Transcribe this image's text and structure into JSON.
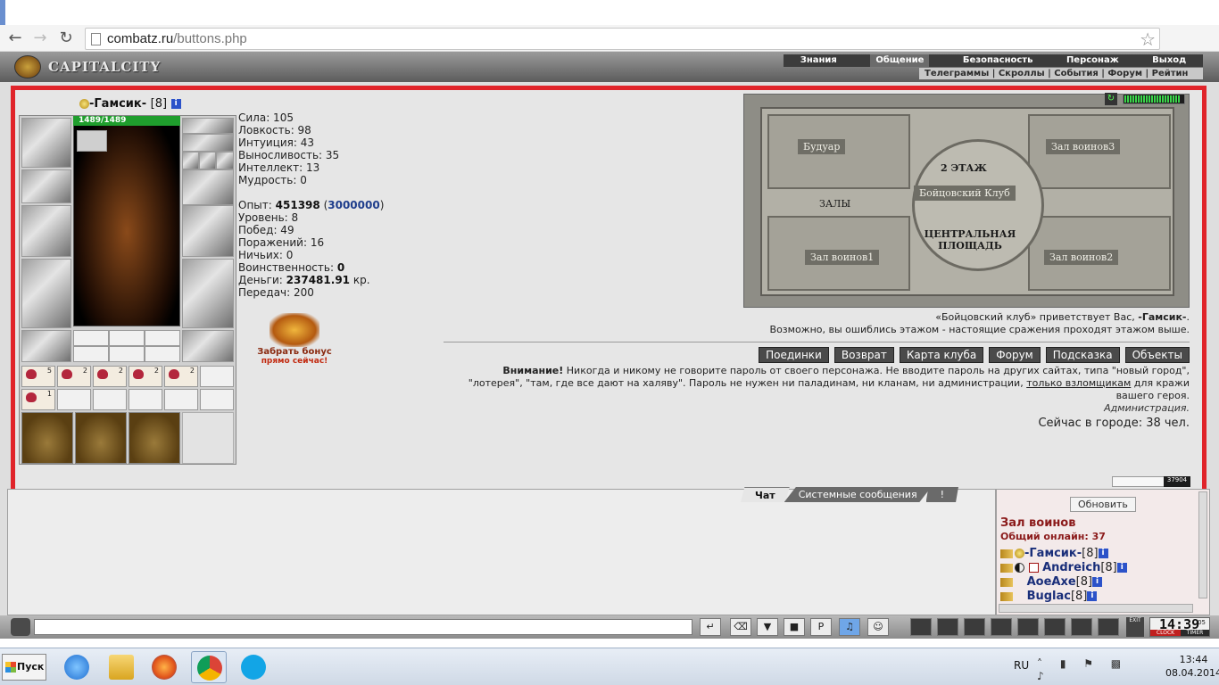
{
  "browser": {
    "url_host": "combatz.ru",
    "url_path": "/buttons.php"
  },
  "game": {
    "logo": "CAPITALCITY",
    "main_menu": [
      "Знания",
      "Общение",
      "Безопасность",
      "Персонаж",
      "Выход"
    ],
    "main_menu_active": "Общение",
    "sub_menu": "Телеграммы | Скроллы | События | Форум | Рейтин"
  },
  "character": {
    "name": "-Гамсик-",
    "level": "[8]",
    "hp": "1489/1489",
    "stats": {
      "strength": "Сила: 105",
      "agility": "Ловкость: 98",
      "intuition": "Интуиция: 43",
      "endurance": "Выносливость: 35",
      "intellect": "Интеллект: 13",
      "wisdom": "Мудрость: 0"
    },
    "exp_label": "Опыт:",
    "exp_value": "451398",
    "exp_next": "3000000",
    "level_line": "Уровень: 8",
    "wins": "Побед: 49",
    "losses": "Поражений: 16",
    "draws": "Ничьих: 0",
    "militancy_label": "Воинственность:",
    "militancy_value": "0",
    "money_label": "Деньги:",
    "money_value": "237481.91",
    "money_unit": "кр.",
    "transfers": "Передач: 200",
    "scroll_counts": [
      "5",
      "2",
      "2",
      "2",
      "2",
      "1"
    ],
    "bonus_line1": "Забрать бонус",
    "bonus_line2": "прямо сейчас!"
  },
  "map": {
    "rooms": {
      "boudoir": "Будуар",
      "hall3": "Зал воинов3",
      "floor2": "2 ЭТАЖ",
      "club": "Бойцовский Клуб",
      "halls": "ЗАЛЫ",
      "plaza": "ЦЕНТРАЛЬНАЯ ПЛОЩАДЬ",
      "hall1": "Зал воинов1",
      "hall2": "Зал воинов2"
    },
    "energy_level": 0.95
  },
  "welcome": {
    "line1_pre": "«Бойцовский клуб» приветствует Вас,",
    "line1_name": "-Гамсик-",
    "line1_end": ".",
    "line2": "Возможно, вы ошиблись этажом - настоящие сражения проходят этажом выше."
  },
  "buttons": [
    "Поединки",
    "Возврат",
    "Карта клуба",
    "Форум",
    "Подсказка",
    "Объекты"
  ],
  "warning": {
    "bold": "Внимание!",
    "text1": " Никогда и никому не говорите пароль от своего персонажа. Не вводите пароль на других сайтах, типа \"новый город\", \"лотерея\", \"там, где все дают на халяву\". Пароль не нужен ни паладинам, ни кланам, ни администрации, ",
    "link": "только взломщикам",
    "text2": " для кражи вашего героя.",
    "signature": "Администрация."
  },
  "online_city": "Сейчас в городе: 38 чел.",
  "chat": {
    "tabs": [
      "Чат",
      "Системные сообщения",
      "!"
    ],
    "active_tab": "Чат"
  },
  "counter": "37904",
  "userlist": {
    "refresh": "Обновить",
    "room": "Зал воинов",
    "online": "Общий онлайн: 37",
    "users": [
      {
        "name": "-Гамсик-",
        "level": "[8]"
      },
      {
        "name": "Andreich",
        "level": "[8]"
      },
      {
        "name": "AoeAxe",
        "level": "[8]"
      },
      {
        "name": "Buglac",
        "level": "[8]"
      }
    ]
  },
  "clock": {
    "time": "14:39",
    "sec": "05",
    "label1": "CLOCK",
    "label2": "TIMER",
    "exit": "EXIT"
  },
  "taskbar": {
    "start": "Пуск",
    "lang": "RU",
    "time": "13:44",
    "date": "08.04.2014"
  }
}
